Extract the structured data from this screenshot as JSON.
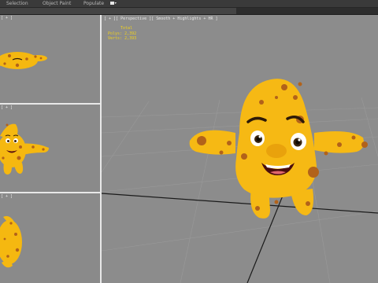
{
  "menubar": {
    "selection": "Selection",
    "object_paint": "Object Paint",
    "populate": "Populate"
  },
  "viewports": {
    "top": {
      "label": "[ + ]"
    },
    "front": {
      "label": "[ + ]"
    },
    "left": {
      "label": "[ + ]"
    },
    "perspective": {
      "label": "[ + ][ Perspective ][ Smooth + Highlights + HR ]"
    }
  },
  "stats": {
    "total": "Total",
    "polys_label": "Polys:",
    "polys": "2,392",
    "verts_label": "Verts:",
    "verts": "2,393"
  },
  "colors": {
    "character_yellow": "#f5b810",
    "spots": "#b2621a",
    "viewport_bg": "#8c8c8c",
    "stats_text": "#f2d21a"
  }
}
